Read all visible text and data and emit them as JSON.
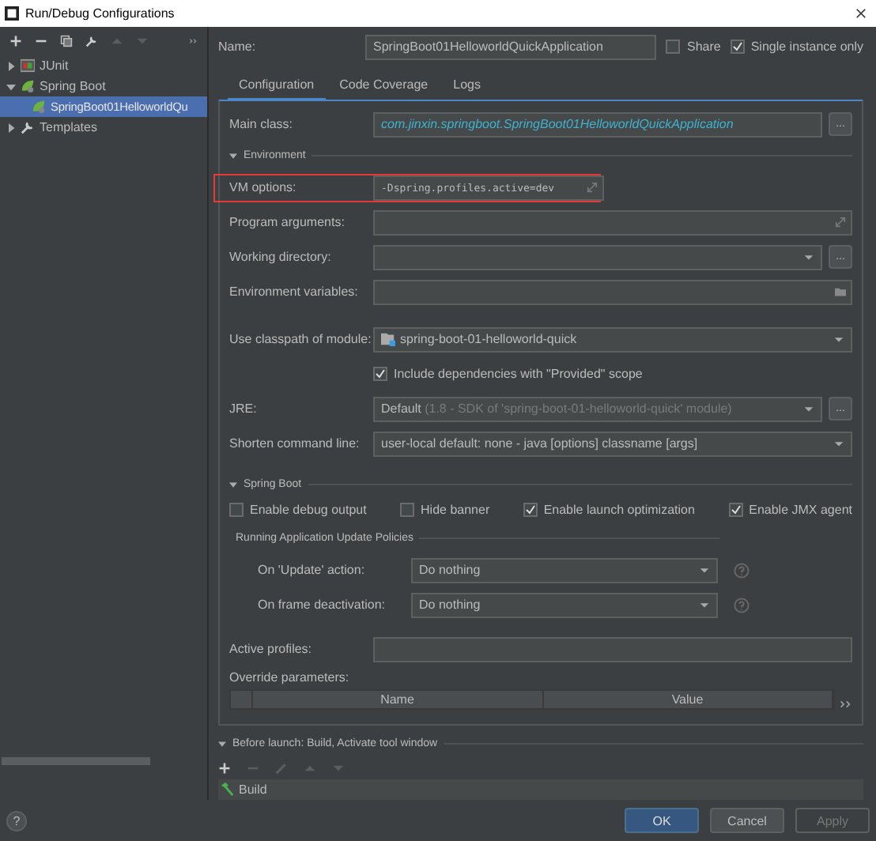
{
  "window": {
    "title": "Run/Debug Configurations"
  },
  "tree": [
    {
      "label": "JUnit",
      "kind": "junit",
      "expanded": false,
      "selected": false
    },
    {
      "label": "Spring Boot",
      "kind": "spring",
      "expanded": true,
      "selected": false,
      "children": [
        {
          "label": "SpringBoot01HelloworldQu",
          "selected": true
        }
      ]
    },
    {
      "label": "Templates",
      "kind": "wrench",
      "expanded": false,
      "selected": false
    }
  ],
  "name_field": {
    "label": "Name:",
    "value": "SpringBoot01HelloworldQuickApplication"
  },
  "options": [
    {
      "label": "Share",
      "checked": false
    },
    {
      "label": "Single instance only",
      "checked": true
    }
  ],
  "tabs": [
    {
      "label": "Configuration",
      "selected": true
    },
    {
      "label": "Code Coverage",
      "selected": false
    },
    {
      "label": "Logs",
      "selected": false
    }
  ],
  "main_class": {
    "label": "Main class:",
    "value": "com.jinxin.springboot.SpringBoot01HelloworldQuickApplication",
    "button": "..."
  },
  "environment": {
    "title": "Environment",
    "rows": [
      {
        "kind": "expand",
        "label": "VM options:",
        "value": "-Dspring.profiles.active=dev",
        "highlighted": true
      },
      {
        "kind": "expand",
        "label": "Program arguments:",
        "highlighted": false
      },
      {
        "kind": "combo-browse",
        "label": "Working directory:",
        "button": "...",
        "highlighted": false
      },
      {
        "kind": "folder",
        "label": "Environment variables:",
        "highlighted": false
      },
      {
        "kind": "module",
        "label": "Use classpath of module:",
        "value": "spring-boot-01-helloworld-quick",
        "highlighted": false
      },
      {
        "kind": "checkbox",
        "label": "Include dependencies with \"Provided\" scope",
        "checked": true,
        "highlighted": false
      },
      {
        "kind": "jre",
        "label": "JRE:",
        "value": "Default",
        "hint": "(1.8 - SDK of 'spring-boot-01-helloworld-quick' module)",
        "button": "...",
        "highlighted": false
      },
      {
        "kind": "combo",
        "label": "Shorten command line:",
        "value": "user-local default: none - java [options] classname [args]",
        "highlighted": false
      }
    ]
  },
  "spring_boot": {
    "title": "Spring Boot",
    "checkboxes": [
      {
        "label": "Enable debug output",
        "checked": false
      },
      {
        "label": "Hide banner",
        "checked": false
      },
      {
        "label": "Enable launch optimization",
        "checked": true
      },
      {
        "label": "Enable JMX agent",
        "checked": true
      }
    ],
    "policies_title": "Running Application Update Policies",
    "policies": [
      {
        "label": "On 'Update' action:",
        "value": "Do nothing"
      },
      {
        "label": "On frame deactivation:",
        "value": "Do nothing"
      }
    ],
    "active_profiles": {
      "label": "Active profiles:"
    },
    "override_label": "Override parameters:",
    "table_columns": [
      "Name",
      "Value"
    ]
  },
  "before_launch": {
    "title": "Before launch: Build, Activate tool window",
    "tasks": [
      "Build"
    ]
  },
  "help_button": "?",
  "buttons": [
    {
      "label": "OK",
      "kind": "primary"
    },
    {
      "label": "Cancel",
      "kind": "normal"
    },
    {
      "label": "Apply",
      "kind": "disabled"
    }
  ]
}
